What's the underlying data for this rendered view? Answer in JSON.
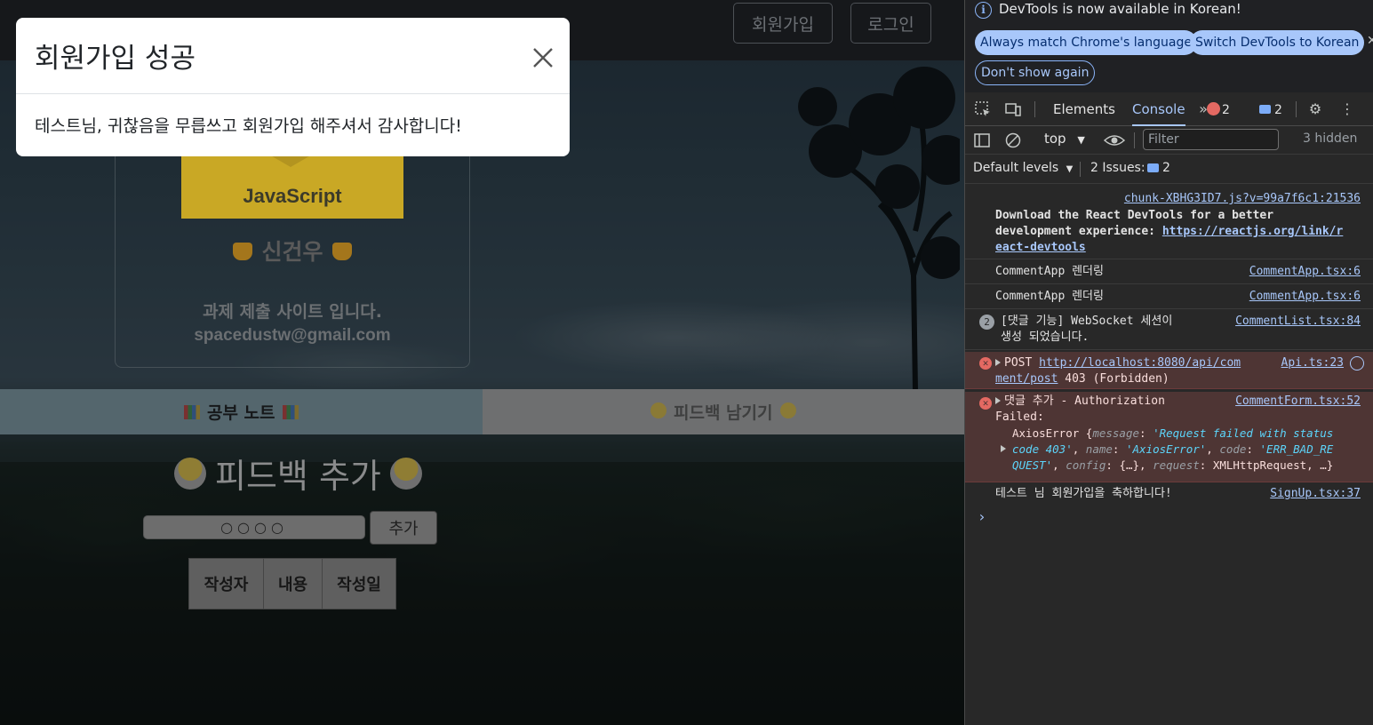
{
  "nav": {
    "signup_label": "회원가입",
    "login_label": "로그인"
  },
  "modal": {
    "title": "회원가입 성공",
    "body": "테스트님, 귀찮음을 무릅쓰고 회원가입 해주셔서 감사합니다!"
  },
  "profile": {
    "logo_text": "JavaScript",
    "name": "신건우",
    "description": "과제 제출 사이트 입니다.",
    "email": "spacedustw@gmail.com"
  },
  "tabs": {
    "study": "공부 노트",
    "feedback": "피드백 남기기"
  },
  "feedback": {
    "title": "피드백 추가",
    "input_value": "○○○○",
    "add_button": "추가",
    "table_headers": [
      "작성자",
      "내용",
      "작성일"
    ]
  },
  "devtools": {
    "info_text": "DevTools is now available in Korean!",
    "btn_match": "Always match Chrome's language",
    "btn_switch": "Switch DevTools to Korean",
    "btn_dont_show": "Don't show again",
    "tab_elements": "Elements",
    "tab_console": "Console",
    "error_count": "2",
    "message_count": "2",
    "context": "top",
    "filter_placeholder": "Filter",
    "hidden": "3 hidden",
    "default_levels": "Default levels",
    "issues_label": "2 Issues:",
    "issues_count": "2",
    "colors": {
      "error": "#e46962",
      "link": "#a8c7fa",
      "accent": "#a8c7fa"
    }
  },
  "console": {
    "log1": {
      "source": "chunk-XBHG3ID7.js?v=99a7f6c1:21536",
      "text_a": "Download the React DevTools for a better",
      "text_b": "development experience: ",
      "link_a": "https://reactjs.org/link/r",
      "link_b": "eact-devtools"
    },
    "log2": {
      "text": "CommentApp 렌더링",
      "source": "CommentApp.tsx:6"
    },
    "log3": {
      "text": "CommentApp 렌더링",
      "source": "CommentApp.tsx:6"
    },
    "log4": {
      "count": "2",
      "text_a": "[댓글 기능] WebSocket 세션이",
      "text_b": "생성 되었습니다.",
      "source": "CommentList.tsx:84"
    },
    "err1": {
      "method": "POST ",
      "url_a": "http://localhost:8080/api/com",
      "url_b": "ment/post",
      "status": " 403 (Forbidden)",
      "source": "Api.ts:23"
    },
    "err2": {
      "text_a": "댓글 추가 - Authorization",
      "text_b": "Failed:",
      "source": "CommentForm.tsx:52",
      "err_name": "AxiosError",
      "k_message": "message",
      "v_message_a": "'Request failed with status",
      "v_message_b": "code 403'",
      "k_name": "name",
      "v_name": "'AxiosError'",
      "k_code": "code",
      "v_code_a": "'ERR_BAD_RE",
      "v_code_b": "QUEST'",
      "k_config": "config",
      "v_config": "{…}",
      "k_request": "request",
      "v_request": "XMLHttpRequest, …}"
    },
    "log5": {
      "text": "테스트 님 회원가입을 축하합니다!",
      "source": "SignUp.tsx:37"
    }
  }
}
